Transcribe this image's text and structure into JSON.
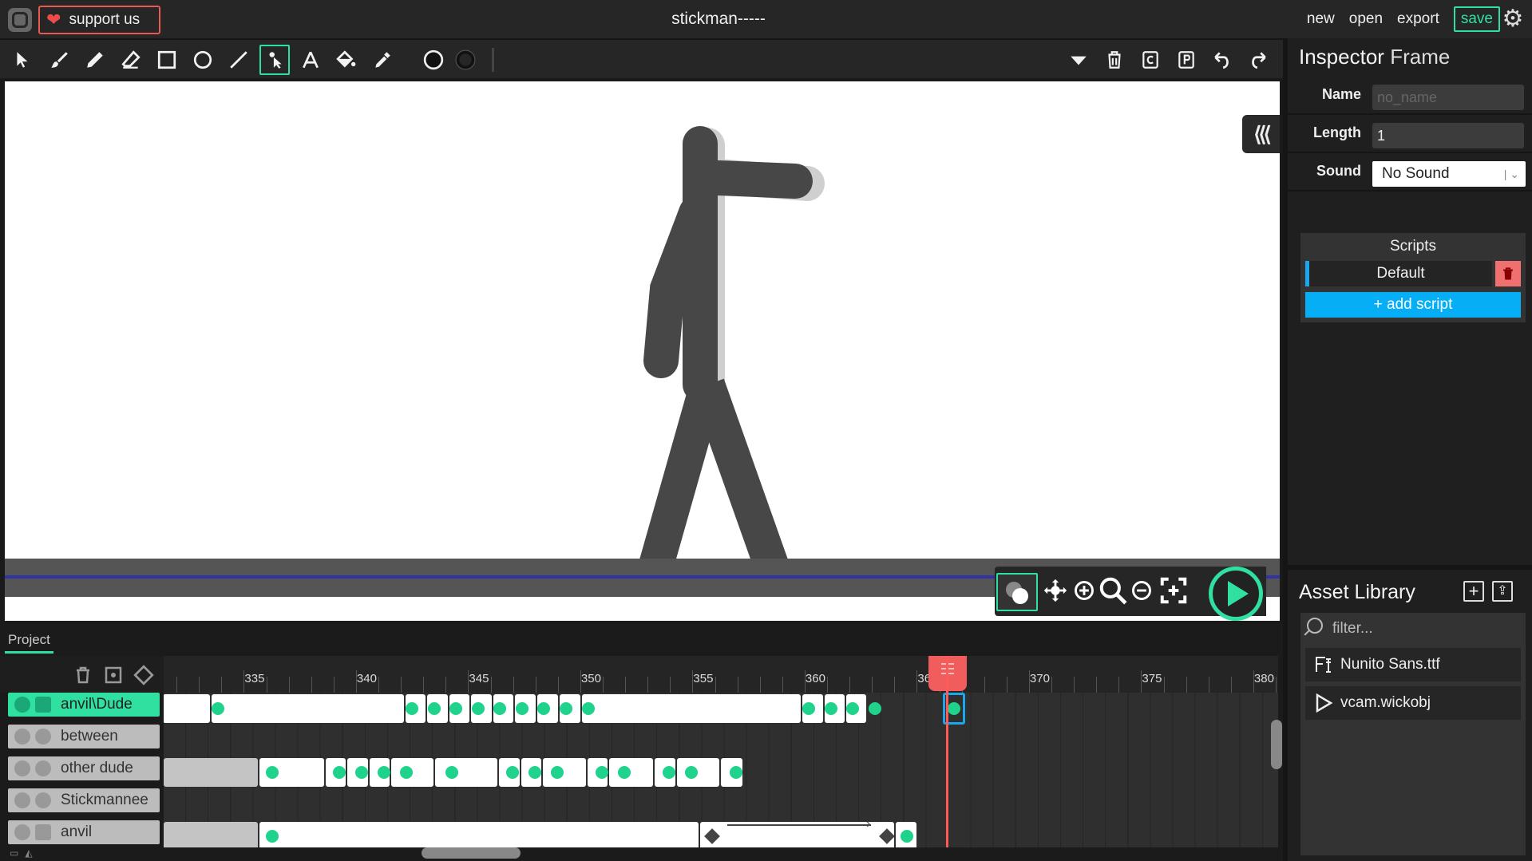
{
  "app": {
    "title": "stickman-----",
    "support_label": "support us",
    "menu": [
      "new",
      "open",
      "export"
    ],
    "save_label": "save"
  },
  "inspector": {
    "title": "Inspector",
    "subtitle": "Frame",
    "name_label": "Name",
    "name_placeholder": "no_name",
    "length_label": "Length",
    "length_value": "1",
    "sound_label": "Sound",
    "sound_value": "No Sound",
    "scripts_title": "Scripts",
    "script_default": "Default",
    "add_script": "+ add script"
  },
  "assets": {
    "title": "Asset Library",
    "filter_placeholder": "filter...",
    "items": [
      "Nunito Sans.ttf",
      "vcam.wickobj"
    ]
  },
  "timeline": {
    "tab": "Project",
    "layers": [
      "anvil\\Dude",
      "between",
      "other dude",
      "Stickmannee",
      "anvil"
    ],
    "ruler_labels": [
      "335",
      "340",
      "345",
      "350",
      "355",
      "360",
      "365",
      "370",
      "375",
      "380"
    ],
    "playhead_frame": 367
  },
  "colors": {
    "accent": "#2fe0a0",
    "support_border": "#e85a4f",
    "script_accent": "#06aff5",
    "playhead": "#f15d5d"
  }
}
